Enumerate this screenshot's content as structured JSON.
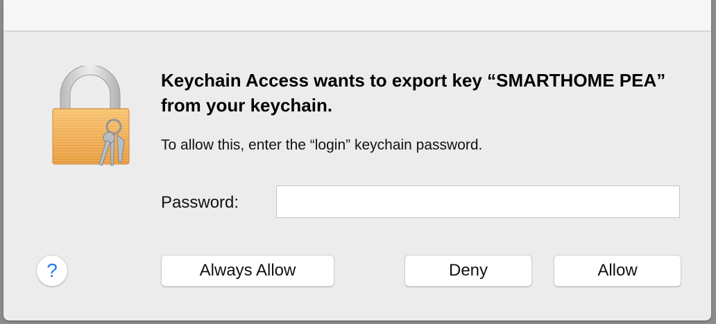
{
  "dialog": {
    "title": "Keychain Access wants to export key “SMARTHOME PEA” from your keychain.",
    "message": "To allow this, enter the “login” keychain password.",
    "password_label": "Password:",
    "password_value": "",
    "icon": "keychain-lock-icon",
    "buttons": {
      "help": "?",
      "always_allow": "Always Allow",
      "deny": "Deny",
      "allow": "Allow"
    },
    "colors": {
      "accent": "#1e7cf5",
      "lock_body": "#f0a94a",
      "background": "#ececec"
    }
  }
}
